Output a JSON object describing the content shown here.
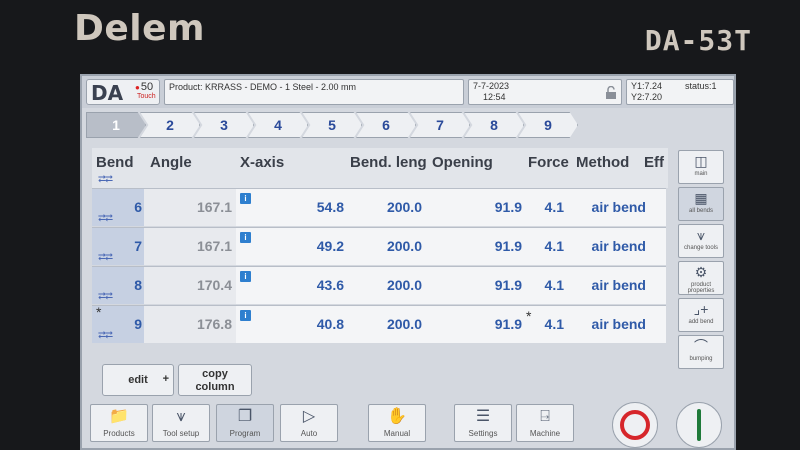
{
  "bezel": {
    "brand": "Delem",
    "model": "DA-53T"
  },
  "header": {
    "logo_da": "DA",
    "logo_num": "50",
    "logo_sub": "Touch",
    "product": "Product: KRRASS - DEMO - 1 Steel - 2.00 mm",
    "date": "7-7-2023",
    "time": "12:54",
    "y1": "Y1:7.24",
    "y2": "Y2:7.20",
    "status": "status:1"
  },
  "steps": [
    "1",
    "2",
    "3",
    "4",
    "5",
    "6",
    "7",
    "8",
    "9"
  ],
  "active_step": "1",
  "table": {
    "headers": [
      "Bend",
      "Angle",
      "X-axis",
      "Bend. leng",
      "Opening",
      "Force",
      "Method",
      "Eff"
    ],
    "rows": [
      {
        "bend": "6",
        "angle": "167.1",
        "x_axis": "54.8",
        "bend_length": "200.0",
        "opening": "91.9",
        "force": "4.1",
        "method": "air bend",
        "star_bend": "",
        "star_force": ""
      },
      {
        "bend": "7",
        "angle": "167.1",
        "x_axis": "49.2",
        "bend_length": "200.0",
        "opening": "91.9",
        "force": "4.1",
        "method": "air bend",
        "star_bend": "",
        "star_force": ""
      },
      {
        "bend": "8",
        "angle": "170.4",
        "x_axis": "43.6",
        "bend_length": "200.0",
        "opening": "91.9",
        "force": "4.1",
        "method": "air bend",
        "star_bend": "",
        "star_force": ""
      },
      {
        "bend": "9",
        "angle": "176.8",
        "x_axis": "40.8",
        "bend_length": "200.0",
        "opening": "91.9",
        "force": "4.1",
        "method": "air bend",
        "star_bend": "*",
        "star_force": "*"
      }
    ]
  },
  "side_buttons": {
    "main": "main",
    "all_bends": "all bends",
    "change_tools": "change tools",
    "product_properties": "product properties",
    "add_bend": "add bend",
    "bumping": "bumping"
  },
  "actions": {
    "edit": "edit",
    "copy_column_1": "copy",
    "copy_column_2": "column"
  },
  "nav": {
    "products": "Products",
    "tool_setup": "Tool setup",
    "program": "Program",
    "auto": "Auto",
    "manual": "Manual",
    "settings": "Settings",
    "machine": "Machine"
  },
  "colors": {
    "stop": "#d6262b",
    "start": "#1f7a3a",
    "value_blue": "#2f5aa8"
  }
}
